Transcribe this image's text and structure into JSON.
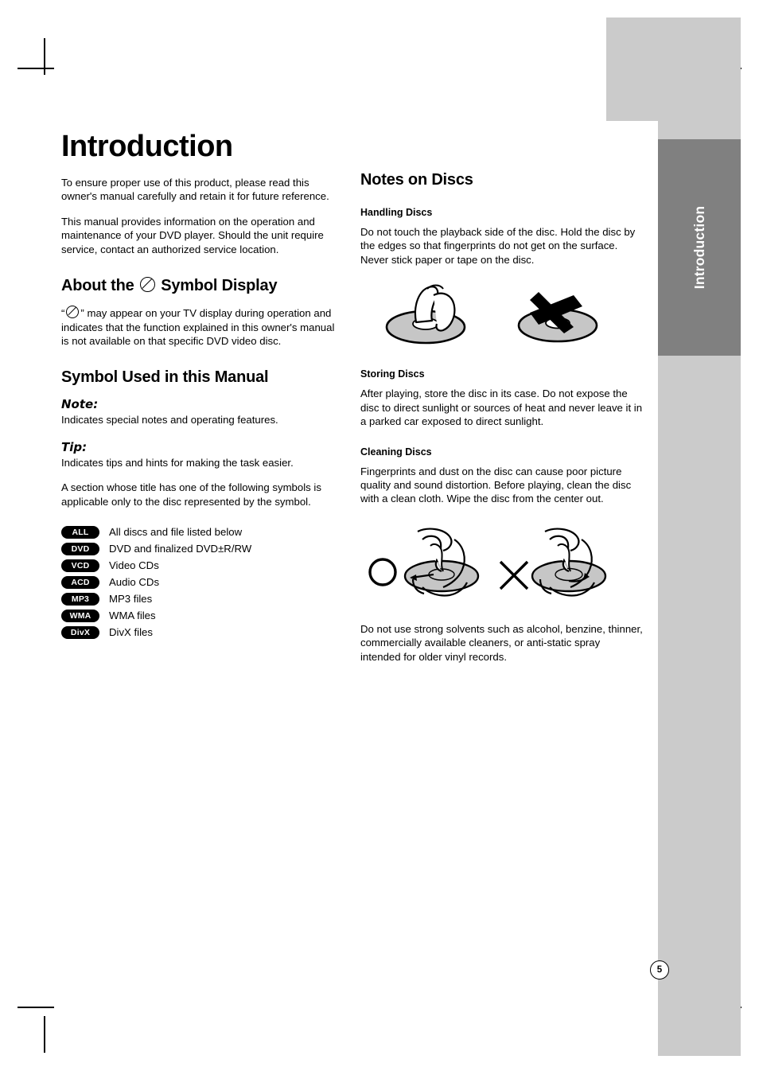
{
  "page": {
    "number": "5",
    "tab_label": "Introduction"
  },
  "left_column": {
    "chapter_title": "Introduction",
    "intro_paragraph_1": "To ensure proper use of this product, please read this owner's manual carefully and retain it for future reference.",
    "intro_paragraph_2": "This manual provides information on the operation and maintenance of your DVD player. Should the unit require service, contact an authorized service location.",
    "symbol_display": {
      "heading_before": "About the",
      "heading_after": "Symbol Display",
      "body_before": "“",
      "body_after": "” may appear on your TV display during operation and indicates that the function explained in this owner's manual is not available on that specific DVD video disc."
    },
    "symbol_manual": {
      "heading": "Symbol Used in this Manual",
      "note_label": "Note:",
      "note_text": "Indicates special notes and operating features.",
      "tip_label": "Tip:",
      "tip_text": "Indicates tips and hints for making the task easier.",
      "applicable_text": "A section whose title has one of the following symbols is applicable only to the disc represented by the symbol."
    },
    "badges": [
      {
        "code": "ALL",
        "description": "All discs and file listed below"
      },
      {
        "code": "DVD",
        "description": "DVD and finalized DVD±R/RW"
      },
      {
        "code": "VCD",
        "description": "Video CDs"
      },
      {
        "code": "ACD",
        "description": "Audio CDs"
      },
      {
        "code": "MP3",
        "description": "MP3 files"
      },
      {
        "code": "WMA",
        "description": "WMA files"
      },
      {
        "code": "DivX",
        "description": "DivX files"
      }
    ]
  },
  "right_column": {
    "heading": "Notes on Discs",
    "handling": {
      "heading": "Handling Discs",
      "text": "Do not touch the playback side of the disc. Hold the disc by the edges so that fingerprints do not get on the surface. Never stick paper or tape on the disc."
    },
    "storing": {
      "heading": "Storing Discs",
      "text": "After playing, store the disc in its case. Do not expose the disc to direct sunlight or sources of heat and never leave it in a parked car exposed to direct sunlight."
    },
    "cleaning": {
      "heading": "Cleaning Discs",
      "text": "Fingerprints and dust on the disc can cause poor picture quality and sound distortion. Before playing, clean the disc with a clean cloth. Wipe the disc from the center out.",
      "warning": "Do not use strong solvents such as alcohol, benzine, thinner, commercially available cleaners, or anti-static spray intended for older vinyl records."
    }
  },
  "colors": {
    "tab_dark": "#808080",
    "tab_light": "#cbcbcb",
    "badge": "#000000",
    "disc_fill": "#c6c6c6"
  }
}
